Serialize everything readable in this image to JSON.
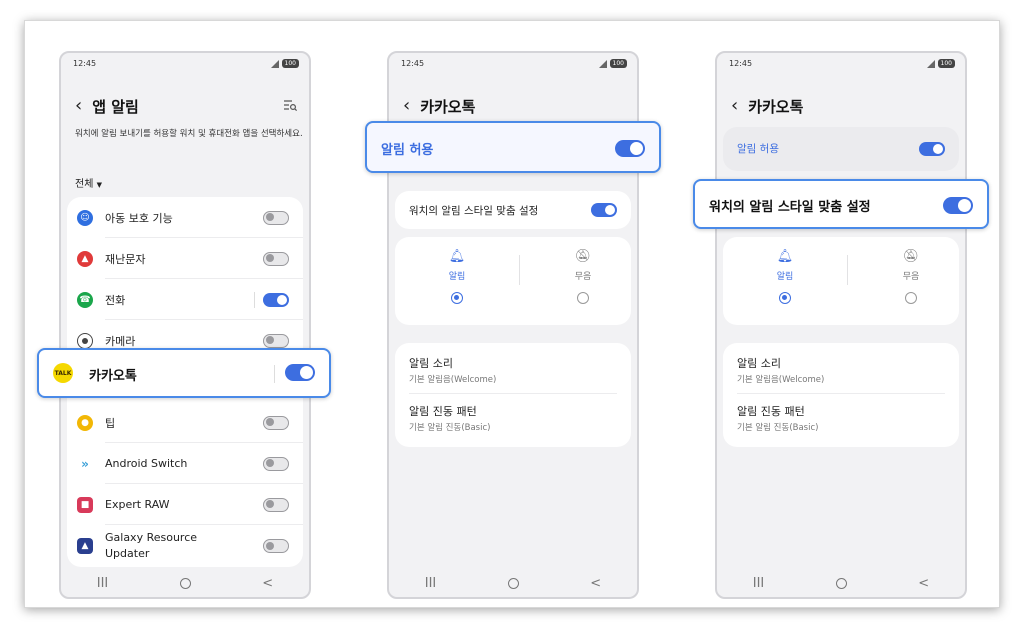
{
  "phone1": {
    "status": {
      "time": "12:45",
      "battery": "100"
    },
    "title": "앱 알림",
    "description": "워치에 알림 보내기를 허용할 워치 및 휴대전화 앱을 선택하세요.",
    "filter_label": "전체",
    "apps": [
      {
        "label": "아동 보호 기능",
        "on": false,
        "color": "#2f6fe0"
      },
      {
        "label": "재난문자",
        "on": false,
        "color": "#e03a3a"
      },
      {
        "label": "전화",
        "on": true,
        "color": "#1aa64b"
      },
      {
        "label": "카메라",
        "on": false,
        "color": "#444444"
      },
      {
        "label": "팁",
        "on": false,
        "color": "#f2b705"
      },
      {
        "label": "Android Switch",
        "on": false,
        "color": "#3aa0d8"
      },
      {
        "label": "Expert RAW",
        "on": false,
        "color": "#d83a5a"
      },
      {
        "label": "Galaxy Resource Updater",
        "on": false,
        "color": "#2a3f8f"
      }
    ],
    "highlight": {
      "label": "카카오톡",
      "icon_text": "TALK",
      "on": true,
      "color": "#f5d800"
    }
  },
  "phone2": {
    "status": {
      "time": "12:45",
      "battery": "100"
    },
    "title": "카카오톡",
    "allow_label": "알림 허용",
    "watch_style_label": "워치의 알림 스타일 맞춤 설정",
    "option_alert": "알림",
    "option_mute": "무음",
    "sound_title": "알림 소리",
    "sound_value": "기본 알림음(Welcome)",
    "vibration_title": "알림 진동 패턴",
    "vibration_value": "기본 알림 진동(Basic)"
  },
  "phone3": {
    "status": {
      "time": "12:45",
      "battery": "100"
    },
    "title": "카카오톡",
    "allow_label": "알림 허용",
    "watch_style_label": "워치의 알림 스타일 맞춤 설정",
    "option_alert": "알림",
    "option_mute": "무음",
    "sound_title": "알림 소리",
    "sound_value": "기본 알림음(Welcome)",
    "vibration_title": "알림 진동 패턴",
    "vibration_value": "기본 알림 진동(Basic)"
  },
  "navbar": {
    "recents": "III",
    "back": "<"
  },
  "colors": {
    "accent": "#3d6ee0",
    "highlight_border": "#4a8ae8"
  }
}
